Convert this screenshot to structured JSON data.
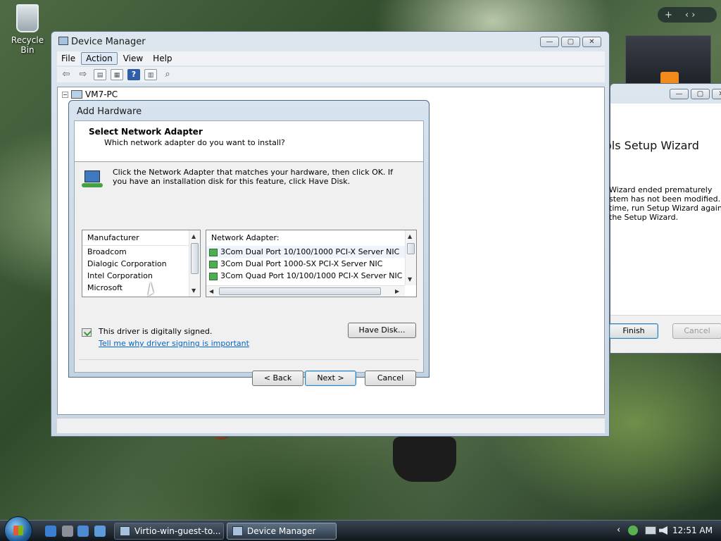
{
  "desktop": {
    "recycle_bin_label": "Recycle Bin"
  },
  "device_manager": {
    "title": "Device Manager",
    "menu": [
      "File",
      "Action",
      "View",
      "Help"
    ],
    "active_menu": "Action",
    "tree_root": "VM7-PC"
  },
  "setup_wizard": {
    "title_partial": "ols Setup Wizard",
    "lines": [
      "Wizard ended prematurely",
      "stem has not been modified. To",
      " time, run Setup Wizard again.",
      " the Setup Wizard."
    ],
    "finish_label": "Finish",
    "cancel_label": "Cancel"
  },
  "add_hardware": {
    "title": "Add Hardware",
    "heading": "Select Network Adapter",
    "subheading": "Which network adapter do you want to install?",
    "instructions": "Click the Network Adapter that matches your hardware, then click OK. If you have an installation disk for this feature, click Have Disk.",
    "manufacturer_header": "Manufacturer",
    "manufacturers": [
      "Broadcom",
      "Dialogic Corporation",
      "Intel Corporation",
      "Microsoft"
    ],
    "adapter_header": "Network Adapter:",
    "adapters": [
      "3Com Dual Port 10/100/1000 PCI-X Server NIC",
      "3Com Dual Port 1000-SX PCI-X Server NIC",
      "3Com Quad Port 10/100/1000 PCI-X Server NIC"
    ],
    "signed_text": "This driver is digitally signed.",
    "signing_link": "Tell me why driver signing is important",
    "have_disk_label": "Have Disk...",
    "back_label": "< Back",
    "next_label": "Next >",
    "cancel_label": "Cancel"
  },
  "taskbar": {
    "tasks": [
      "Virtio-win-guest-to...",
      "Device Manager"
    ],
    "clock": "12:51 AM"
  }
}
